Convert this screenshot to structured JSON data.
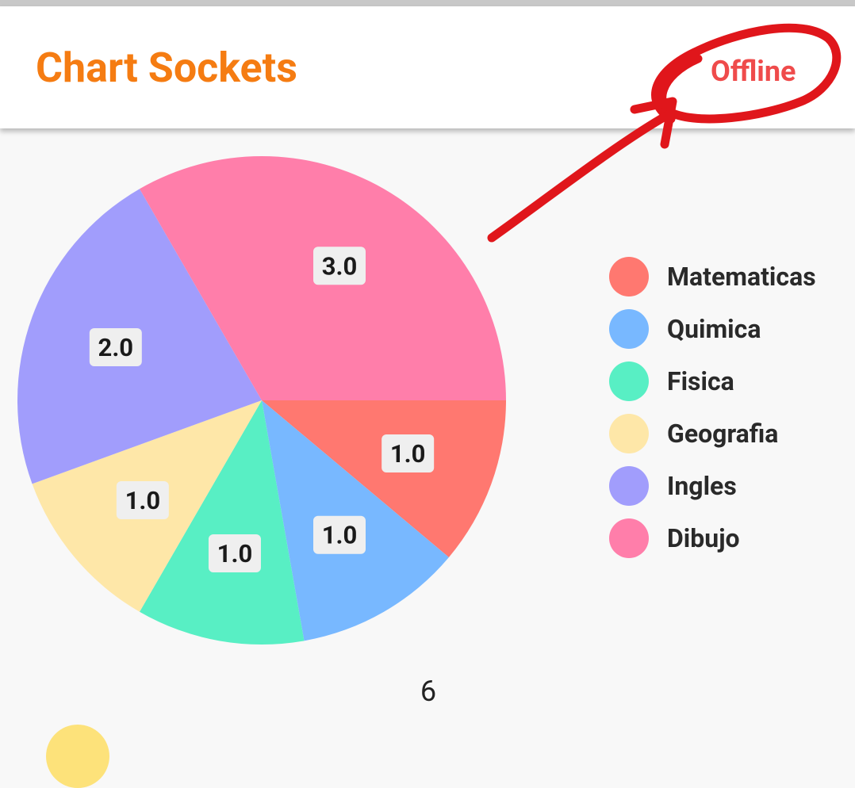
{
  "app_bar": {
    "title": "Chart Sockets",
    "status": "Offline",
    "colors": {
      "title": "#f57c12",
      "status": "#ef4b4b",
      "annotation": "#e0161b"
    }
  },
  "chart_data": {
    "type": "pie",
    "categories": [
      "Matematicas",
      "Quimica",
      "Fisica",
      "Geografia",
      "Ingles",
      "Dibujo"
    ],
    "values": [
      1.0,
      1.0,
      1.0,
      1.0,
      2.0,
      3.0
    ],
    "value_labels": [
      "1.0",
      "1.0",
      "1.0",
      "1.0",
      "2.0",
      "3.0"
    ],
    "colors": [
      "#ff7870",
      "#78b8ff",
      "#58efc4",
      "#fee7a8",
      "#a19dfc",
      "#ff7eaa"
    ],
    "legend_position": "right"
  },
  "footer": {
    "count": "6"
  }
}
